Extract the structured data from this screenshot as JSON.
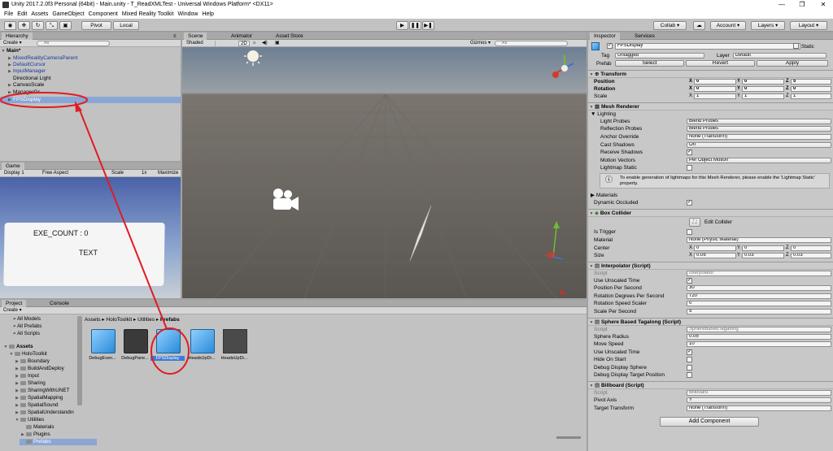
{
  "window": {
    "title": "Unity 2017.2.0f3 Personal (64bit) - Main.unity - T_ReadXMLTest - Universal Windows Platform* <DX11>",
    "minimize": "—",
    "maximize": "❐",
    "close": "✕"
  },
  "menu": [
    "File",
    "Edit",
    "Assets",
    "GameObject",
    "Component",
    "Mixed Reality Toolkit",
    "Window",
    "Help"
  ],
  "toolbar": {
    "pivot": "Pivot",
    "local": "Local",
    "play": "▶",
    "pause": "❚❚",
    "step": "▶❚",
    "collab": "Collab ▾",
    "account": "Account ▾",
    "layers": "Layers ▾",
    "layout": "Layout ▾"
  },
  "hierarchy": {
    "tab": "Hierarchy",
    "create": "Create ▾",
    "search": "All",
    "scene": "Main*",
    "items": [
      "MixedRealityCameraParent",
      "DefaultCursor",
      "InputManager",
      "Directional Light",
      "CanvasScale",
      "ManagerGr",
      "FPSDisplay"
    ]
  },
  "scene": {
    "tabs": [
      "Scene",
      "Animator",
      "Asset Store"
    ],
    "shaded": "Shaded",
    "two_d": "2D",
    "gizmos": "Gizmos ▾",
    "search": "All"
  },
  "game": {
    "tab": "Game",
    "display": "Display 1",
    "aspect": "Free Aspect",
    "scale": "Scale",
    "scale_val": "1x",
    "maximize": "Maximize",
    "exe_count": "EXE_COUNT : 0",
    "text": "TEXT"
  },
  "project": {
    "tabs": [
      "Project",
      "Console"
    ],
    "create": "Create ▾",
    "favorites": [
      "All Models",
      "All Prefabs",
      "All Scripts"
    ],
    "assets_root": "Assets",
    "tree": [
      "HoloToolkit",
      "Boundary",
      "BuildAndDeploy",
      "Input",
      "Sharing",
      "SharingWithUNET",
      "SpatialMapping",
      "SpatialSound",
      "SpatialUnderstandin",
      "Utilities",
      "Materials",
      "Plugins",
      "Prefabs"
    ],
    "breadcrumb": [
      "Assets",
      "HoloToolkit",
      "Utilities",
      "Prefabs"
    ],
    "assets": [
      "DebugEven...",
      "DebugPane...",
      "FPSDisplay",
      "HeadsUpDi...",
      "HeadsUpDi..."
    ]
  },
  "inspector": {
    "tabs": [
      "Inspector",
      "Services"
    ],
    "object_name": "FPSDisplay",
    "static": "Static",
    "tag_label": "Tag",
    "tag": "Untagged",
    "layer_label": "Layer",
    "layer": "Default",
    "prefab_label": "Prefab",
    "select": "Select",
    "revert": "Revert",
    "apply": "Apply",
    "transform": {
      "title": "Transform",
      "position": "Position",
      "rotation": "Rotation",
      "scale": "Scale",
      "pos": [
        "0",
        "0",
        "5"
      ],
      "rot": [
        "0",
        "0",
        "0"
      ],
      "scl": [
        "1",
        "1",
        "1"
      ]
    },
    "mesh_renderer": {
      "title": "Mesh Renderer",
      "lighting": "Lighting",
      "light_probes": "Light Probes",
      "light_probes_v": "Blend Probes",
      "reflection_probes": "Reflection Probes",
      "reflection_probes_v": "Blend Probes",
      "anchor_override": "Anchor Override",
      "anchor_override_v": "None (Transform)",
      "cast_shadows": "Cast Shadows",
      "cast_shadows_v": "On",
      "receive_shadows": "Receive Shadows",
      "motion_vectors": "Motion Vectors",
      "motion_vectors_v": "Per Object Motion",
      "lightmap_static": "Lightmap Static",
      "info": "To enable generation of lightmaps for this Mesh Renderer, please enable the 'Lightmap Static' property.",
      "materials": "Materials",
      "dynamic_occluded": "Dynamic Occluded"
    },
    "box_collider": {
      "title": "Box Collider",
      "edit": "Edit Collider",
      "is_trigger": "Is Trigger",
      "material": "Material",
      "material_v": "None (Physic Material)",
      "center": "Center",
      "size": "Size",
      "center_v": [
        "0",
        "0",
        "0"
      ],
      "size_v": [
        "0.05",
        "0.03",
        "0.03"
      ]
    },
    "interpolator": {
      "title": "Interpolator (Script)",
      "script": "Script",
      "script_v": "Interpolator",
      "use_unscaled": "Use Unscaled Time",
      "pos_per_sec": "Position Per Second",
      "pos_per_sec_v": "30",
      "rot_deg": "Rotation Degrees Per Second",
      "rot_deg_v": "720",
      "rot_speed": "Rotation Speed Scaler",
      "rot_speed_v": "0",
      "scale_per_sec": "Scale Per Second",
      "scale_per_sec_v": "5"
    },
    "tagalong": {
      "title": "Sphere Based Tagalong (Script)",
      "script": "Script",
      "script_v": "SphereBasedTagalong",
      "radius": "Sphere Radius",
      "radius_v": "0.05",
      "move_speed": "Move Speed",
      "move_speed_v": "10",
      "use_unscaled": "Use Unscaled Time",
      "hide_on_start": "Hide On Start",
      "debug_sphere": "Debug Display Sphere",
      "debug_target": "Debug Display Target Position"
    },
    "billboard": {
      "title": "Billboard (Script)",
      "script": "Script",
      "script_v": "Billboard",
      "pivot": "Pivot Axis",
      "pivot_v": "Y",
      "target": "Target Transform",
      "target_v": "None (Transform)"
    },
    "add_component": "Add Component"
  },
  "colors": {
    "annotation": "#e11b22",
    "selection": "#3e7bd6",
    "play_bg": "#c6c6c6"
  }
}
